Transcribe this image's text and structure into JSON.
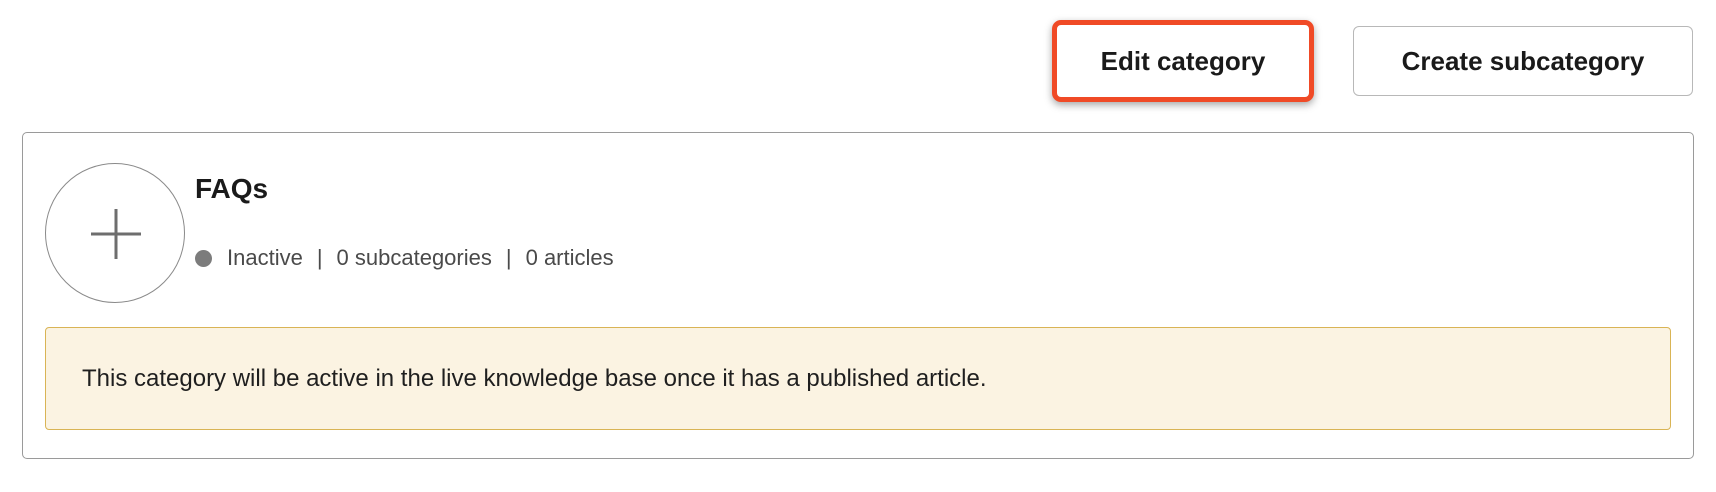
{
  "toolbar": {
    "edit_label": "Edit category",
    "create_label": "Create subcategory"
  },
  "category": {
    "icon": "plus-icon",
    "title": "FAQs",
    "status": "Inactive",
    "status_color": "#7c7c7c",
    "subcategories": "0 subcategories",
    "articles": "0 articles",
    "separator": "|"
  },
  "notice": {
    "text": "This category will be active in the live knowledge base once it has a published article.",
    "background": "#fbf3e2",
    "border": "#d9b455"
  },
  "colors": {
    "highlight": "#f04a26"
  }
}
